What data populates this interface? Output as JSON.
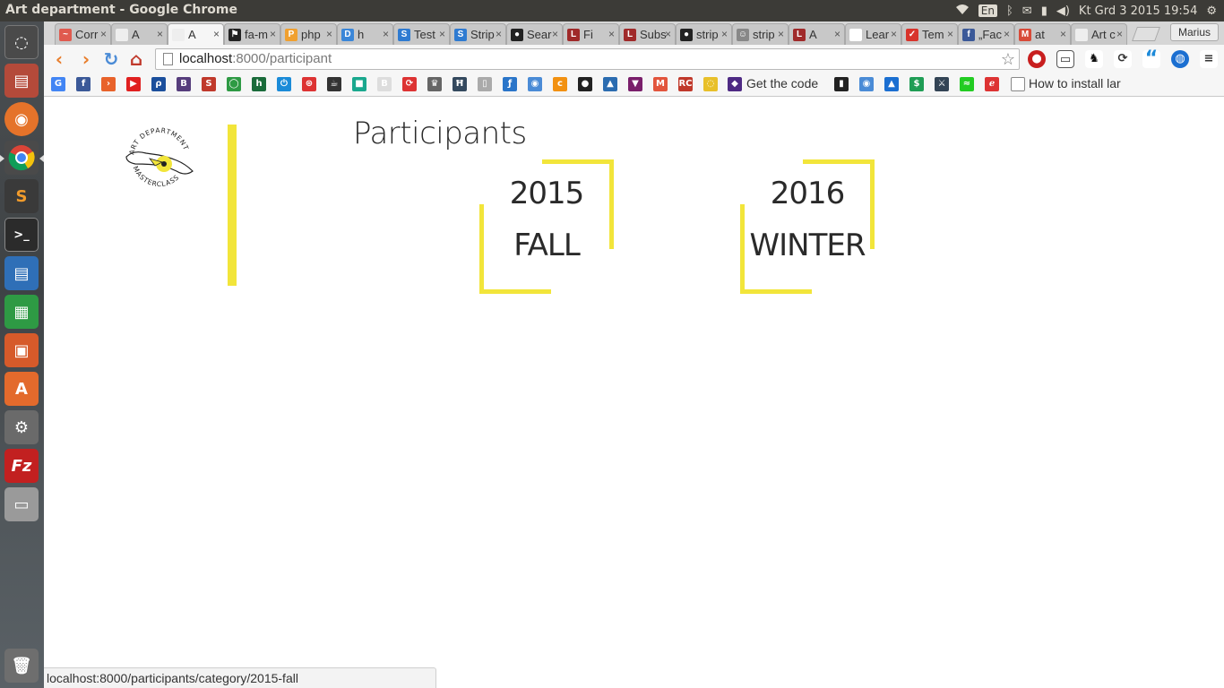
{
  "os": {
    "window_title": "Art department - Google Chrome",
    "language": "En",
    "clock": "Kt Grd  3 2015 19:54"
  },
  "browser": {
    "tabs": [
      {
        "label": "Corr",
        "fav_color": "#e05a4f",
        "fav_text": "~"
      },
      {
        "label": "A",
        "fav_color": "#eeeeee",
        "fav_text": ""
      },
      {
        "label": "A",
        "fav_color": "#eeeeee",
        "fav_text": "",
        "active": true
      },
      {
        "label": "fa-m",
        "fav_color": "#222222",
        "fav_text": "⚑"
      },
      {
        "label": "php",
        "fav_color": "#f0a030",
        "fav_text": "P"
      },
      {
        "label": "h",
        "fav_color": "#3a86d8",
        "fav_text": "D"
      },
      {
        "label": "Test",
        "fav_color": "#2f7bd1",
        "fav_text": "S"
      },
      {
        "label": "Strip",
        "fav_color": "#2f7bd1",
        "fav_text": "S"
      },
      {
        "label": "Sear",
        "fav_color": "#222222",
        "fav_text": "●"
      },
      {
        "label": "Fi",
        "fav_color": "#a02a2a",
        "fav_text": "L"
      },
      {
        "label": "Subs",
        "fav_color": "#a02a2a",
        "fav_text": "L"
      },
      {
        "label": "strip",
        "fav_color": "#222222",
        "fav_text": "●"
      },
      {
        "label": "strip",
        "fav_color": "#888888",
        "fav_text": "☺"
      },
      {
        "label": "A",
        "fav_color": "#a02a2a",
        "fav_text": "L"
      },
      {
        "label": "Lear",
        "fav_color": "#ffffff",
        "fav_text": ""
      },
      {
        "label": "Tem",
        "fav_color": "#d8342c",
        "fav_text": "✓"
      },
      {
        "label": "„Fac",
        "fav_color": "#3b5998",
        "fav_text": "f"
      },
      {
        "label": "at",
        "fav_color": "#d84a38",
        "fav_text": "M"
      },
      {
        "label": "Art c",
        "fav_color": "#eeeeee",
        "fav_text": ""
      }
    ],
    "user": "Marius",
    "url_host": "localhost",
    "url_rest": ":8000/participant",
    "bookmarks": {
      "get_code": "Get the code",
      "install": "How to install lar"
    },
    "status_url": "localhost:8000/participants/category/2015-fall"
  },
  "page": {
    "title": "Participants",
    "logo_top": "ART DEPARTMENT",
    "logo_bottom": "MASTERCLASS",
    "categories": [
      {
        "year": "2015",
        "season": "FALL"
      },
      {
        "year": "2016",
        "season": "WINTER"
      }
    ]
  },
  "colors": {
    "accent": "#f2e53a",
    "text": "#2a2a2a"
  }
}
